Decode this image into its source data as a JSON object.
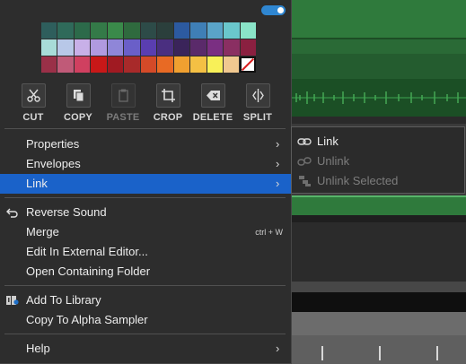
{
  "colors": {
    "menu_bg": "#2d2d2d",
    "highlight": "#1a62c9",
    "toggle": "#2f86d1",
    "text": "#ededed",
    "disabled_text": "#7b7b7b",
    "waveform_green": "#2f7a3c"
  },
  "swatch_rows": [
    [
      "#2e5e5c",
      "#2f6a5a",
      "#2c6a4a",
      "#347a48",
      "#3a8a4a",
      "#2f6a3e",
      "#2d4b48",
      "#2b3f3c",
      "#2c5aa0",
      "#3f7fb6",
      "#5aa4c8",
      "#6ac7cc",
      "#8ae4c8"
    ],
    [
      "#a8dcd8",
      "#b8c8e8",
      "#c8b0e8",
      "#b09ae0",
      "#8f86d8",
      "#6a5fc8",
      "#5a3eb0",
      "#4a2f80",
      "#3a245a",
      "#5a2a6a",
      "#7a2f82",
      "#8a2f62",
      "#8a2040"
    ],
    [
      "#9a3048",
      "#c05a78",
      "#d04060",
      "#c81818",
      "#a01a22",
      "#a82a2a",
      "#d44a28",
      "#e86a24",
      "#f0a030",
      "#f4c044",
      "#f8f058",
      "#f0c890",
      "none"
    ]
  ],
  "tools": [
    {
      "label": "CUT",
      "icon": "scissors-icon",
      "enabled": true
    },
    {
      "label": "COPY",
      "icon": "copy-icon",
      "enabled": true
    },
    {
      "label": "PASTE",
      "icon": "paste-icon",
      "enabled": false
    },
    {
      "label": "CROP",
      "icon": "crop-icon",
      "enabled": true
    },
    {
      "label": "DELETE",
      "icon": "backspace-icon",
      "enabled": true
    },
    {
      "label": "SPLIT",
      "icon": "split-icon",
      "enabled": true
    }
  ],
  "menu": {
    "properties": "Properties",
    "envelopes": "Envelopes",
    "link": "Link",
    "reverse_sound": "Reverse Sound",
    "merge": "Merge",
    "merge_shortcut": "ctrl + W",
    "edit_external": "Edit In External Editor...",
    "open_folder": "Open Containing Folder",
    "add_library": "Add To Library",
    "copy_alpha": "Copy To Alpha Sampler",
    "help": "Help",
    "submenu_arrow": "›"
  },
  "submenu": {
    "link": "Link",
    "unlink": "Unlink",
    "unlink_selected": "Unlink Selected"
  }
}
